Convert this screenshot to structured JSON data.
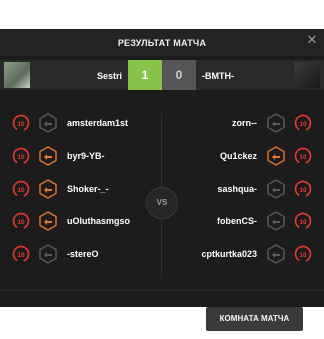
{
  "modal": {
    "title": "РЕЗУЛЬТАТ МАТЧА",
    "close_glyph": "✕"
  },
  "scoreboard": {
    "team_left": "Sestri",
    "team_right": "-BMTH-",
    "score_left": "1",
    "score_right": "0",
    "vs_label": "VS"
  },
  "players_left": [
    {
      "name": "amsterdam1st",
      "level": "10",
      "rank_active": false
    },
    {
      "name": "byr9-YB-",
      "level": "10",
      "rank_active": true
    },
    {
      "name": "Shoker-_-",
      "level": "10",
      "rank_active": true
    },
    {
      "name": "uOluthasmgso",
      "level": "10",
      "rank_active": true
    },
    {
      "name": "-stereO",
      "level": "10",
      "rank_active": false
    }
  ],
  "players_right": [
    {
      "name": "zorn--",
      "level": "10",
      "rank_active": false
    },
    {
      "name": "Qu1ckez",
      "level": "10",
      "rank_active": true
    },
    {
      "name": "sashqua-",
      "level": "10",
      "rank_active": false
    },
    {
      "name": "fobenCS-",
      "level": "10",
      "rank_active": false
    },
    {
      "name": "cptkurtka023",
      "level": "10",
      "rank_active": false
    }
  ],
  "footer": {
    "room_button": "КОМНАТА МАТЧА"
  },
  "colors": {
    "win": "#87c34a",
    "lose": "#555555",
    "level_ring": "#e8392b",
    "rank_active": "#e8762b",
    "rank_inactive": "#5a5a5a"
  }
}
